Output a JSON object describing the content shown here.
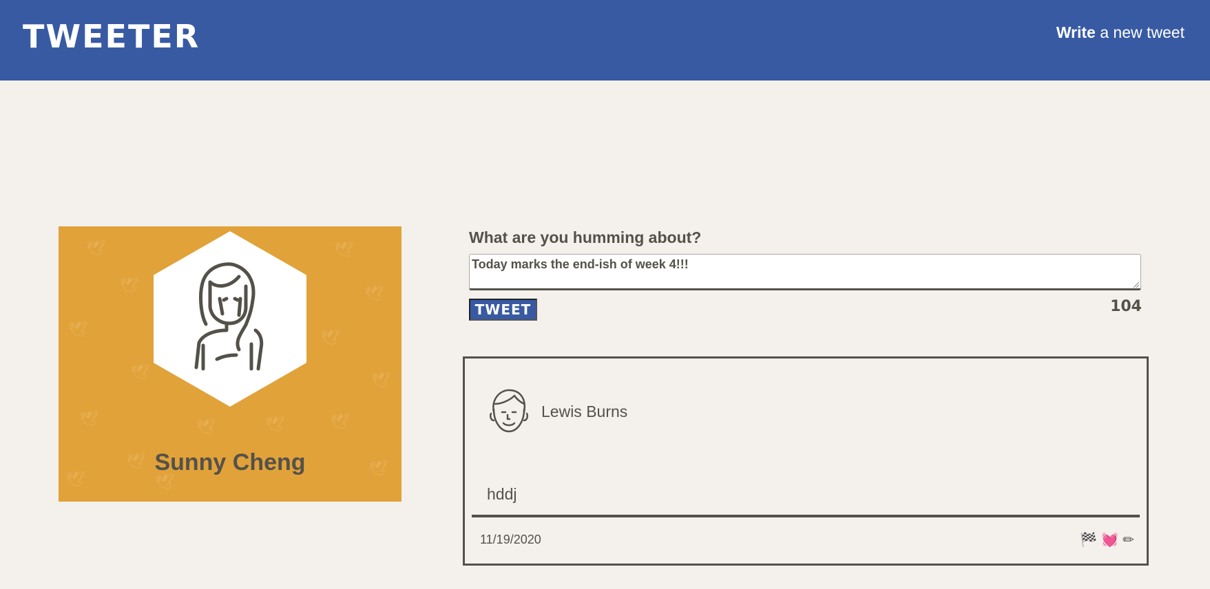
{
  "header": {
    "brand": "TWEETER",
    "write_link_strong": "Write",
    "write_link_rest": " a new tweet"
  },
  "profile": {
    "name": "Sunny Cheng"
  },
  "compose": {
    "label": "What are you humming about?",
    "textarea_value": "Today marks the end-ish of week 4!!!",
    "button_label": "TWEET",
    "char_count": "104"
  },
  "tweets": [
    {
      "author": "Lewis Burns",
      "body": "hddj",
      "date": "11/19/2020",
      "actions": {
        "flag": "🏁",
        "heart": "💓",
        "edit": "✏"
      }
    }
  ],
  "colors": {
    "header_bg": "#385aa3",
    "page_bg": "#f4f1ec",
    "profile_bg": "#e1a23a",
    "text": "#545149"
  },
  "icons": {
    "profile_avatar": "woman-avatar-icon",
    "tweet_avatar": "man-avatar-icon"
  }
}
